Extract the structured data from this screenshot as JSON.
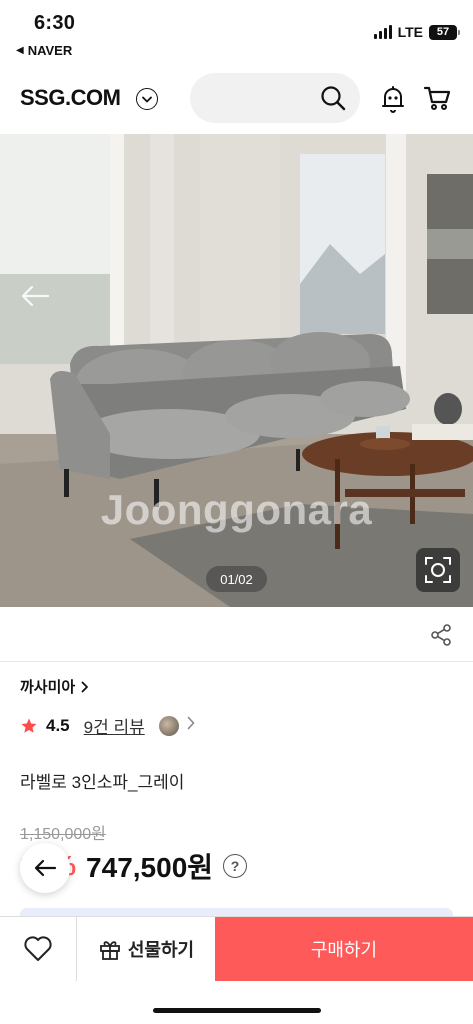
{
  "status_bar": {
    "time": "6:30",
    "back_app": "NAVER",
    "network": "LTE",
    "battery": "57"
  },
  "header": {
    "logo": "SSG.COM",
    "icons": [
      "chevron-down-icon",
      "search-icon",
      "bell-icon",
      "cart-icon"
    ]
  },
  "product_image": {
    "watermark": "Joonggonara",
    "counter": "01/02"
  },
  "product": {
    "brand": "까사미아",
    "rating": "4.5",
    "reviews": "9건 리뷰",
    "title": "라벨로 3인소파_그레이",
    "original_price": "1,150,000원",
    "discount": "35%",
    "price": "747,500원"
  },
  "bottom_bar": {
    "gift_label": "선물하기",
    "buy_label": "구매하기"
  },
  "colors": {
    "accent": "#ff5a5a",
    "text": "#111111",
    "muted": "#999999"
  }
}
